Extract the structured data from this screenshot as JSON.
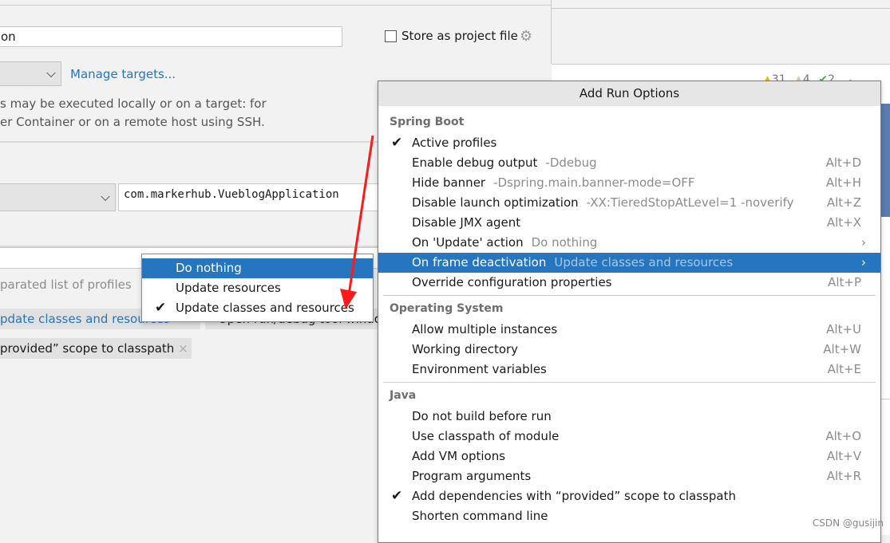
{
  "dialog": {
    "name_value": "on",
    "store_as_project_file": "Store as project file",
    "manage_targets": "Manage targets...",
    "description_line1": "s may be executed locally or on a target: for",
    "description_line2": "er Container or on a remote host using SSH.",
    "main_class_value": "com.markerhub.VueblogApplication",
    "profiles_placeholder": "parated list of profiles",
    "chips": [
      {
        "label": "pdate classes and resources"
      },
      {
        "label": "Open run/debug tool windo"
      },
      {
        "label": "provided” scope to classpath"
      }
    ]
  },
  "dropdown": {
    "items": [
      {
        "label": "Do nothing",
        "selected": true,
        "checked": false
      },
      {
        "label": "Update resources",
        "selected": false,
        "checked": false
      },
      {
        "label": "Update classes and resources",
        "selected": false,
        "checked": true
      }
    ]
  },
  "editor": {
    "warnings": "31",
    "weak_warnings": "4",
    "ok": "2"
  },
  "popup": {
    "title": "Add Run Options",
    "sections": [
      {
        "title": "Spring Boot",
        "items": [
          {
            "label": "Active profiles",
            "checked": true,
            "hint": "",
            "shortcut": ""
          },
          {
            "label": "Enable debug output",
            "hint": "-Ddebug",
            "shortcut": "Alt+D"
          },
          {
            "label": "Hide banner",
            "hint": "-Dspring.main.banner-mode=OFF",
            "shortcut": "Alt+H"
          },
          {
            "label": "Disable launch optimization",
            "hint": "-XX:TieredStopAtLevel=1 -noverify",
            "shortcut": "Alt+Z"
          },
          {
            "label": "Disable JMX agent",
            "hint": "",
            "shortcut": "Alt+X"
          },
          {
            "label": "On 'Update' action",
            "hint": "Do nothing",
            "shortcut": "",
            "submenu": true
          },
          {
            "label": "On frame deactivation",
            "hint": "Update classes and resources",
            "shortcut": "",
            "submenu": true,
            "selected": true
          },
          {
            "label": "Override configuration properties",
            "hint": "",
            "shortcut": "Alt+P"
          }
        ]
      },
      {
        "title": "Operating System",
        "items": [
          {
            "label": "Allow multiple instances",
            "hint": "",
            "shortcut": "Alt+U"
          },
          {
            "label": "Working directory",
            "hint": "",
            "shortcut": "Alt+W"
          },
          {
            "label": "Environment variables",
            "hint": "",
            "shortcut": "Alt+E"
          }
        ]
      },
      {
        "title": "Java",
        "items": [
          {
            "label": "Do not build before run",
            "hint": "",
            "shortcut": ""
          },
          {
            "label": "Use classpath of module",
            "hint": "",
            "shortcut": "Alt+O"
          },
          {
            "label": "Add VM options",
            "hint": "",
            "shortcut": "Alt+V"
          },
          {
            "label": "Program arguments",
            "hint": "",
            "shortcut": "Alt+R"
          },
          {
            "label": "Add dependencies with “provided” scope to classpath",
            "checked": true,
            "hint": "",
            "shortcut": ""
          },
          {
            "label": "Shorten command line",
            "hint": "",
            "shortcut": ""
          }
        ]
      }
    ]
  },
  "watermark": "CSDN @gusijin",
  "colors": {
    "accent": "#2675bf",
    "annotation_arrow": "#ff1a1a"
  }
}
